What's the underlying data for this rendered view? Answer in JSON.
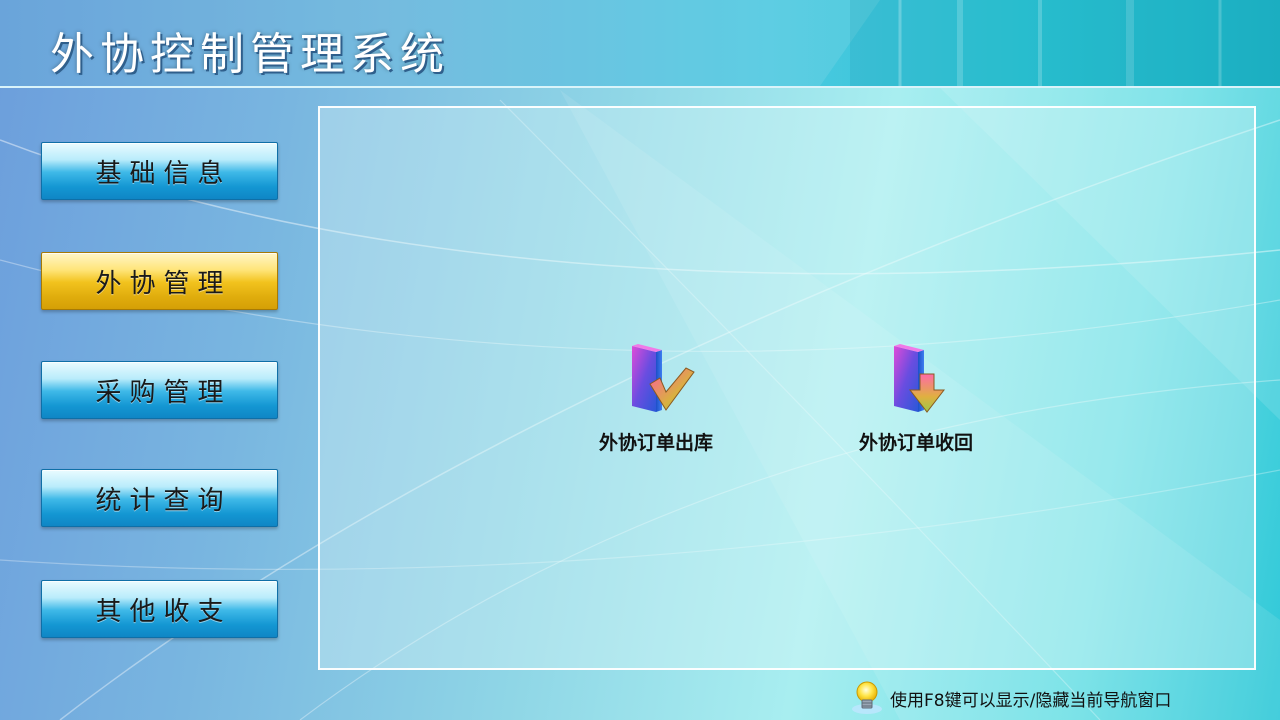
{
  "app": {
    "title": "外协控制管理系统"
  },
  "sidebar": {
    "items": [
      {
        "label": "基础信息",
        "active": false
      },
      {
        "label": "外协管理",
        "active": true
      },
      {
        "label": "采购管理",
        "active": false
      },
      {
        "label": "统计查询",
        "active": false
      },
      {
        "label": "其他收支",
        "active": false
      }
    ]
  },
  "main": {
    "functions": [
      {
        "label": "外协订单出库",
        "icon": "folder-checkmark-icon"
      },
      {
        "label": "外协订单收回",
        "icon": "folder-download-arrow-icon"
      }
    ]
  },
  "footer": {
    "hint": "使用F8键可以显示/隐藏当前导航窗口",
    "icon": "lightbulb-icon"
  },
  "colors": {
    "nav_blue": "#1497d3",
    "nav_active_gold": "#f2c31e",
    "title_text": "#ffffff"
  }
}
